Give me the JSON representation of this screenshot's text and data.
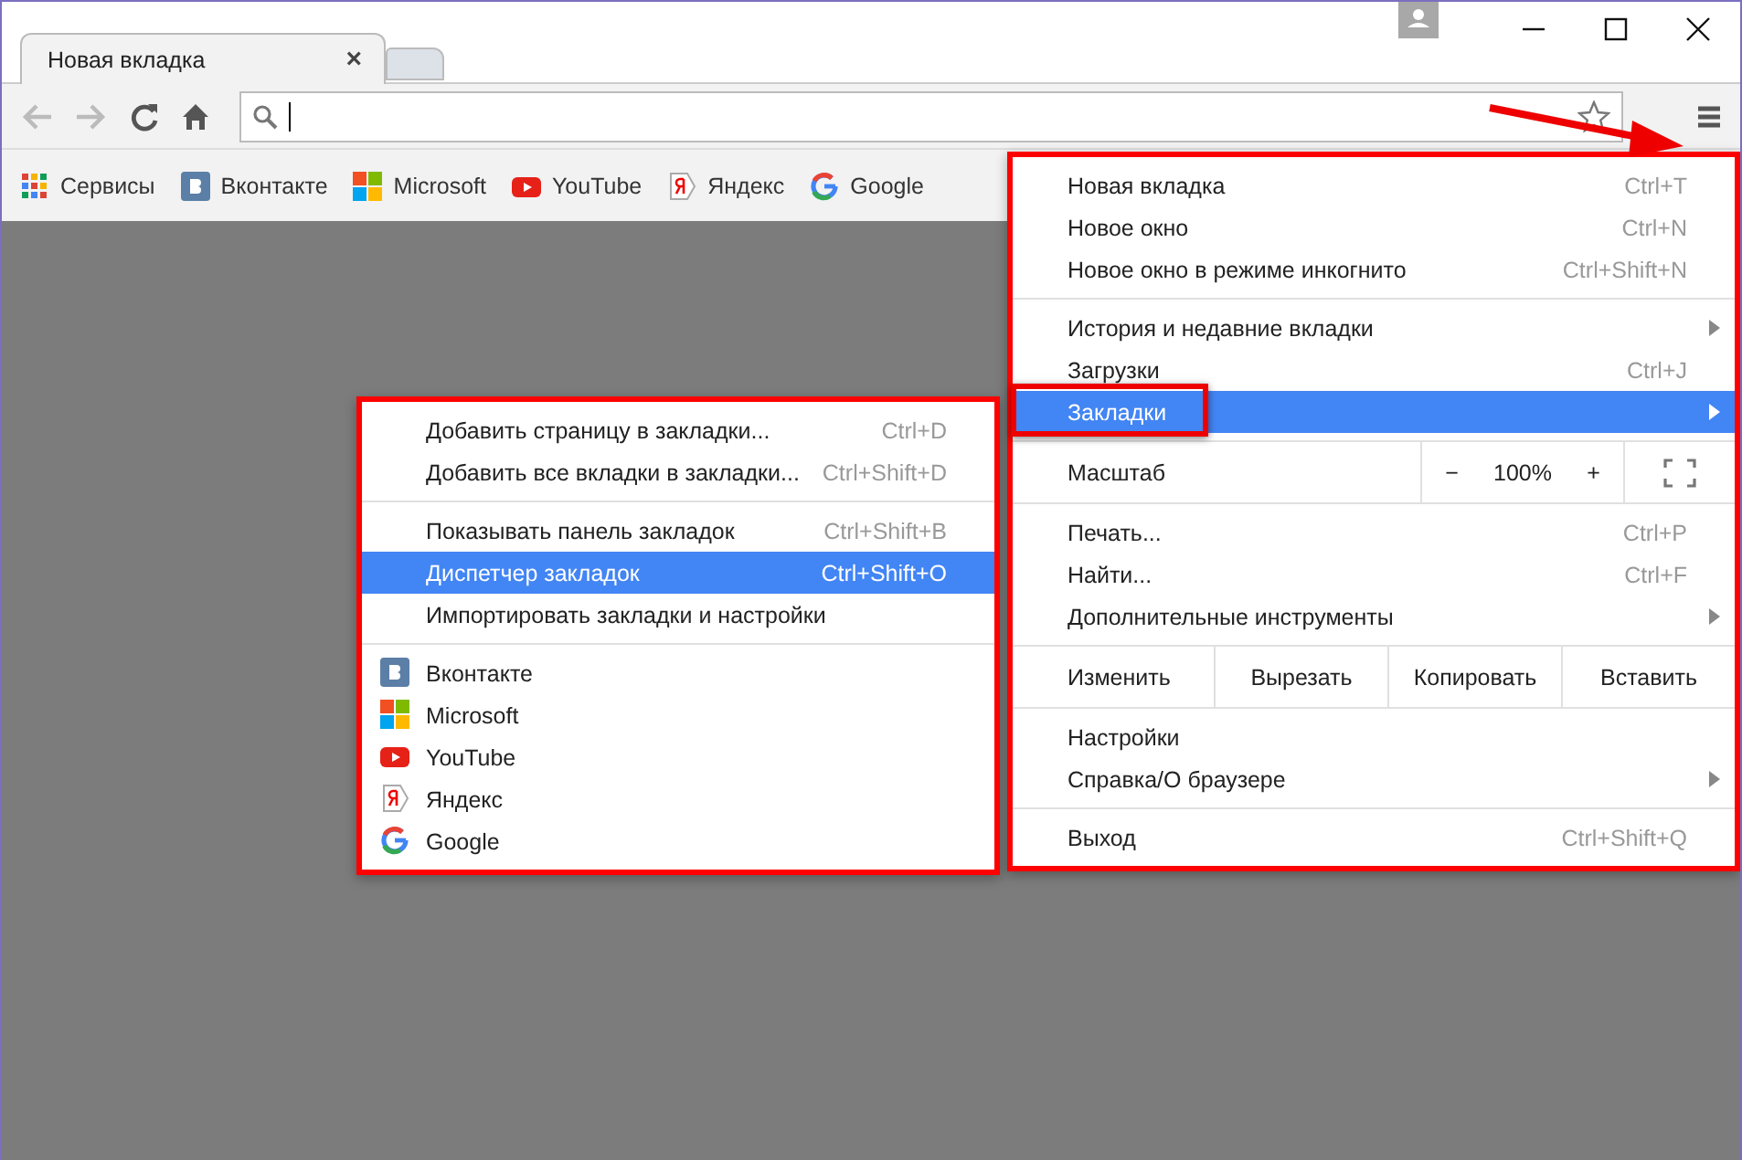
{
  "window": {
    "tab_title": "Новая вкладка",
    "tab_close": "×"
  },
  "bookmarks_bar": [
    {
      "kind": "apps",
      "label": "Сервисы"
    },
    {
      "kind": "vk",
      "label": "Вконтакте"
    },
    {
      "kind": "microsoft",
      "label": "Microsoft"
    },
    {
      "kind": "youtube",
      "label": "YouTube"
    },
    {
      "kind": "yandex",
      "label": "Яндекс"
    },
    {
      "kind": "google",
      "label": "Google"
    }
  ],
  "main_menu": [
    [
      {
        "kind": "item",
        "label": "Новая вкладка",
        "shortcut": "Ctrl+T",
        "submenu": false,
        "selected": false
      },
      {
        "kind": "item",
        "label": "Новое окно",
        "shortcut": "Ctrl+N",
        "submenu": false,
        "selected": false
      },
      {
        "kind": "item",
        "label": "Новое окно в режиме инкогнито",
        "shortcut": "Ctrl+Shift+N",
        "submenu": false,
        "selected": false
      }
    ],
    [
      {
        "kind": "item",
        "label": "История и недавние вкладки",
        "submenu": true,
        "selected": false
      },
      {
        "kind": "item",
        "label": "Загрузки",
        "shortcut": "Ctrl+J",
        "submenu": false,
        "selected": false
      },
      {
        "kind": "item",
        "label": "Закладки",
        "submenu": true,
        "selected": true,
        "annotated": true
      }
    ],
    [
      {
        "kind": "zoom",
        "label": "Масштаб",
        "minus": "−",
        "value": "100%",
        "plus": "+"
      }
    ],
    [
      {
        "kind": "item",
        "label": "Печать...",
        "shortcut": "Ctrl+P",
        "submenu": false,
        "selected": false
      },
      {
        "kind": "item",
        "label": "Найти...",
        "shortcut": "Ctrl+F",
        "submenu": false,
        "selected": false
      },
      {
        "kind": "item",
        "label": "Дополнительные инструменты",
        "submenu": true,
        "selected": false
      }
    ],
    [
      {
        "kind": "edit",
        "label": "Изменить",
        "buttons": [
          "Вырезать",
          "Копировать",
          "Вставить"
        ]
      }
    ],
    [
      {
        "kind": "item",
        "label": "Настройки",
        "submenu": false,
        "selected": false
      },
      {
        "kind": "item",
        "label": "Справка/О браузере",
        "submenu": true,
        "selected": false
      }
    ],
    [
      {
        "kind": "item",
        "label": "Выход",
        "shortcut": "Ctrl+Shift+Q",
        "submenu": false,
        "selected": false
      }
    ]
  ],
  "bookmarks_menu": [
    [
      {
        "kind": "item",
        "label": "Добавить страницу в закладки...",
        "shortcut": "Ctrl+D",
        "selected": false
      },
      {
        "kind": "item",
        "label": "Добавить все вкладки в закладки...",
        "shortcut": "Ctrl+Shift+D",
        "selected": false
      }
    ],
    [
      {
        "kind": "item",
        "label": "Показывать панель закладок",
        "shortcut": "Ctrl+Shift+B",
        "selected": false
      },
      {
        "kind": "item",
        "label": "Диспетчер закладок",
        "shortcut": "Ctrl+Shift+O",
        "selected": true
      },
      {
        "kind": "item",
        "label": "Импортировать закладки и настройки",
        "selected": false
      }
    ],
    [
      {
        "kind": "vk",
        "label": "Вконтакте",
        "selected": false
      },
      {
        "kind": "microsoft",
        "label": "Microsoft",
        "selected": false
      },
      {
        "kind": "youtube",
        "label": "YouTube",
        "selected": false
      },
      {
        "kind": "yandex",
        "label": "Яндекс",
        "selected": false
      },
      {
        "kind": "google",
        "label": "Google",
        "selected": false
      }
    ]
  ]
}
